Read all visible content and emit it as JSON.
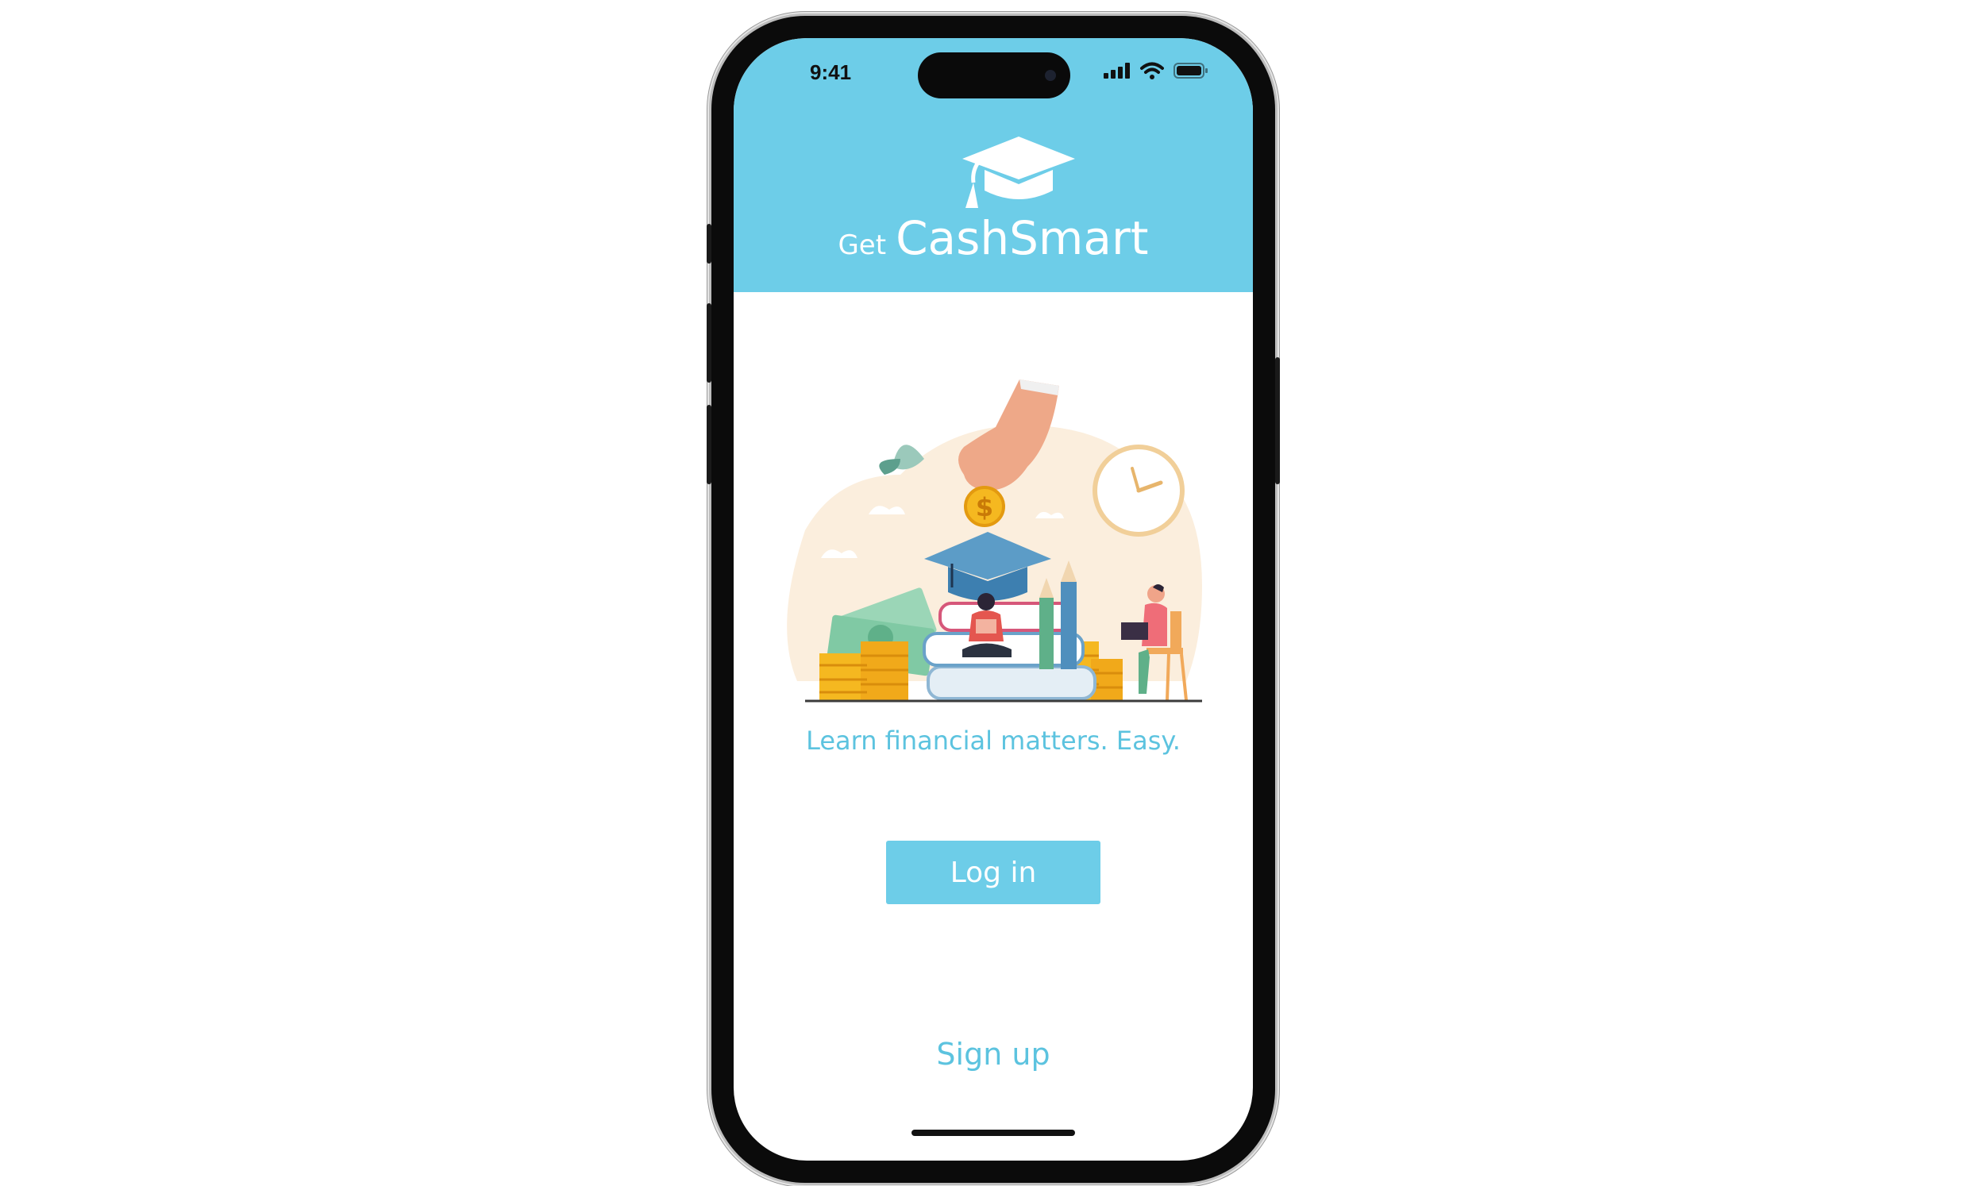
{
  "status_bar": {
    "time": "9:41"
  },
  "app": {
    "logo_prefix": "Get",
    "logo_name": "CashSmart",
    "tagline": "Learn financial matters. Easy.",
    "login_label": "Log in",
    "signup_label": "Sign up"
  },
  "colors": {
    "header_bg": "#6dcde8",
    "accent_text": "#5cc3df",
    "button_bg": "#6dcde8"
  },
  "icons": [
    "graduation-cap-icon",
    "signal-icon",
    "wifi-icon",
    "battery-icon"
  ]
}
